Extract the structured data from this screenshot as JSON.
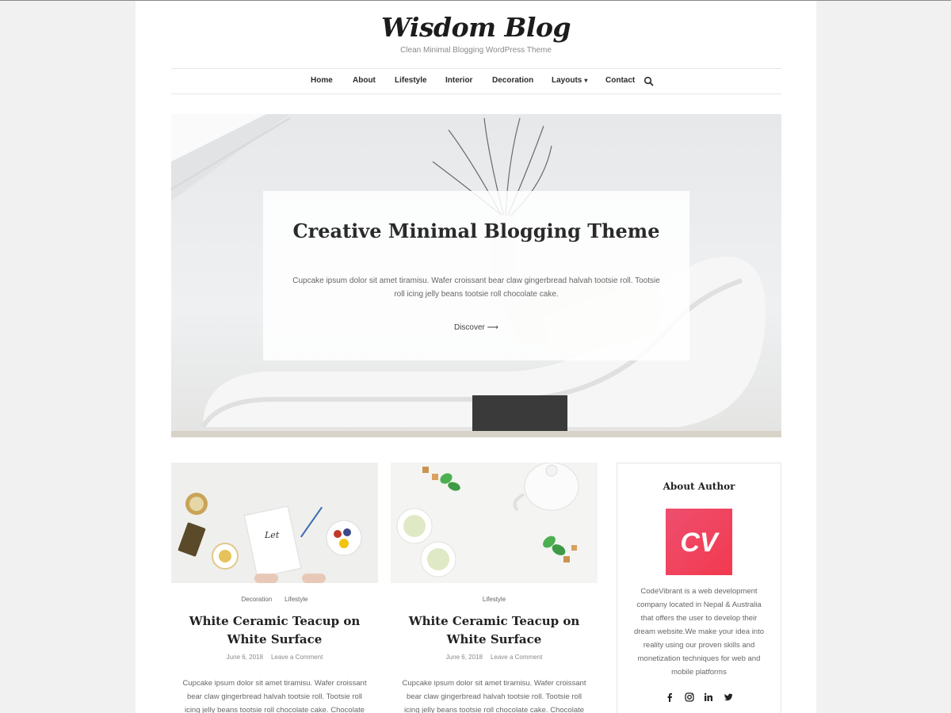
{
  "site": {
    "title": "Wisdom Blog",
    "tagline": "Clean Minimal Blogging WordPress Theme"
  },
  "nav": {
    "items": [
      {
        "label": "Home"
      },
      {
        "label": "About"
      },
      {
        "label": "Lifestyle"
      },
      {
        "label": "Interior"
      },
      {
        "label": "Decoration"
      },
      {
        "label": "Layouts"
      },
      {
        "label": "Contact"
      }
    ],
    "search_icon": "search-icon",
    "dropdown_icon": "chevron-down-icon"
  },
  "hero": {
    "title": "Creative Minimal Blogging Theme",
    "text": "Cupcake ipsum dolor sit amet tiramisu. Wafer croissant bear claw gingerbread halvah tootsie roll. Tootsie roll icing jelly beans tootsie roll chocolate cake.",
    "cta_label": "Discover",
    "cta_icon": "arrow-right-icon"
  },
  "posts": [
    {
      "categories": [
        "Decoration",
        "Lifestyle"
      ],
      "title": "White Ceramic Teacup on White Surface",
      "date": "June 6, 2018",
      "comments": "Leave a Comment",
      "excerpt": "Cupcake ipsum dolor sit amet tiramisu. Wafer croissant bear claw gingerbread halvah tootsie roll. Tootsie roll icing jelly beans tootsie roll chocolate cake. Chocolate"
    },
    {
      "categories": [
        "Lifestyle"
      ],
      "title": "White Ceramic Teacup on White Surface",
      "date": "June 6, 2018",
      "comments": "Leave a Comment",
      "excerpt": "Cupcake ipsum dolor sit amet tiramisu. Wafer croissant bear claw gingerbread halvah tootsie roll. Tootsie roll icing jelly beans tootsie roll chocolate cake. Chocolate"
    }
  ],
  "sidebar": {
    "widget_title": "About Author",
    "logo_text": "CV",
    "bio": "CodeVibrant is a web development company located in Nepal & Australia that offers the user to develop their dream website.We make your idea into reality using our proven skills and monetization techniques for web and mobile platforms",
    "social": [
      "facebook-icon",
      "instagram-icon",
      "linkedin-icon",
      "twitter-icon"
    ]
  },
  "colors": {
    "page_bg": "#f1f1f1",
    "content_bg": "#ffffff",
    "text": "#333333",
    "muted": "#8a8a8a",
    "logo_gradient_start": "#ee4f6f",
    "logo_gradient_end": "#f2394f"
  }
}
